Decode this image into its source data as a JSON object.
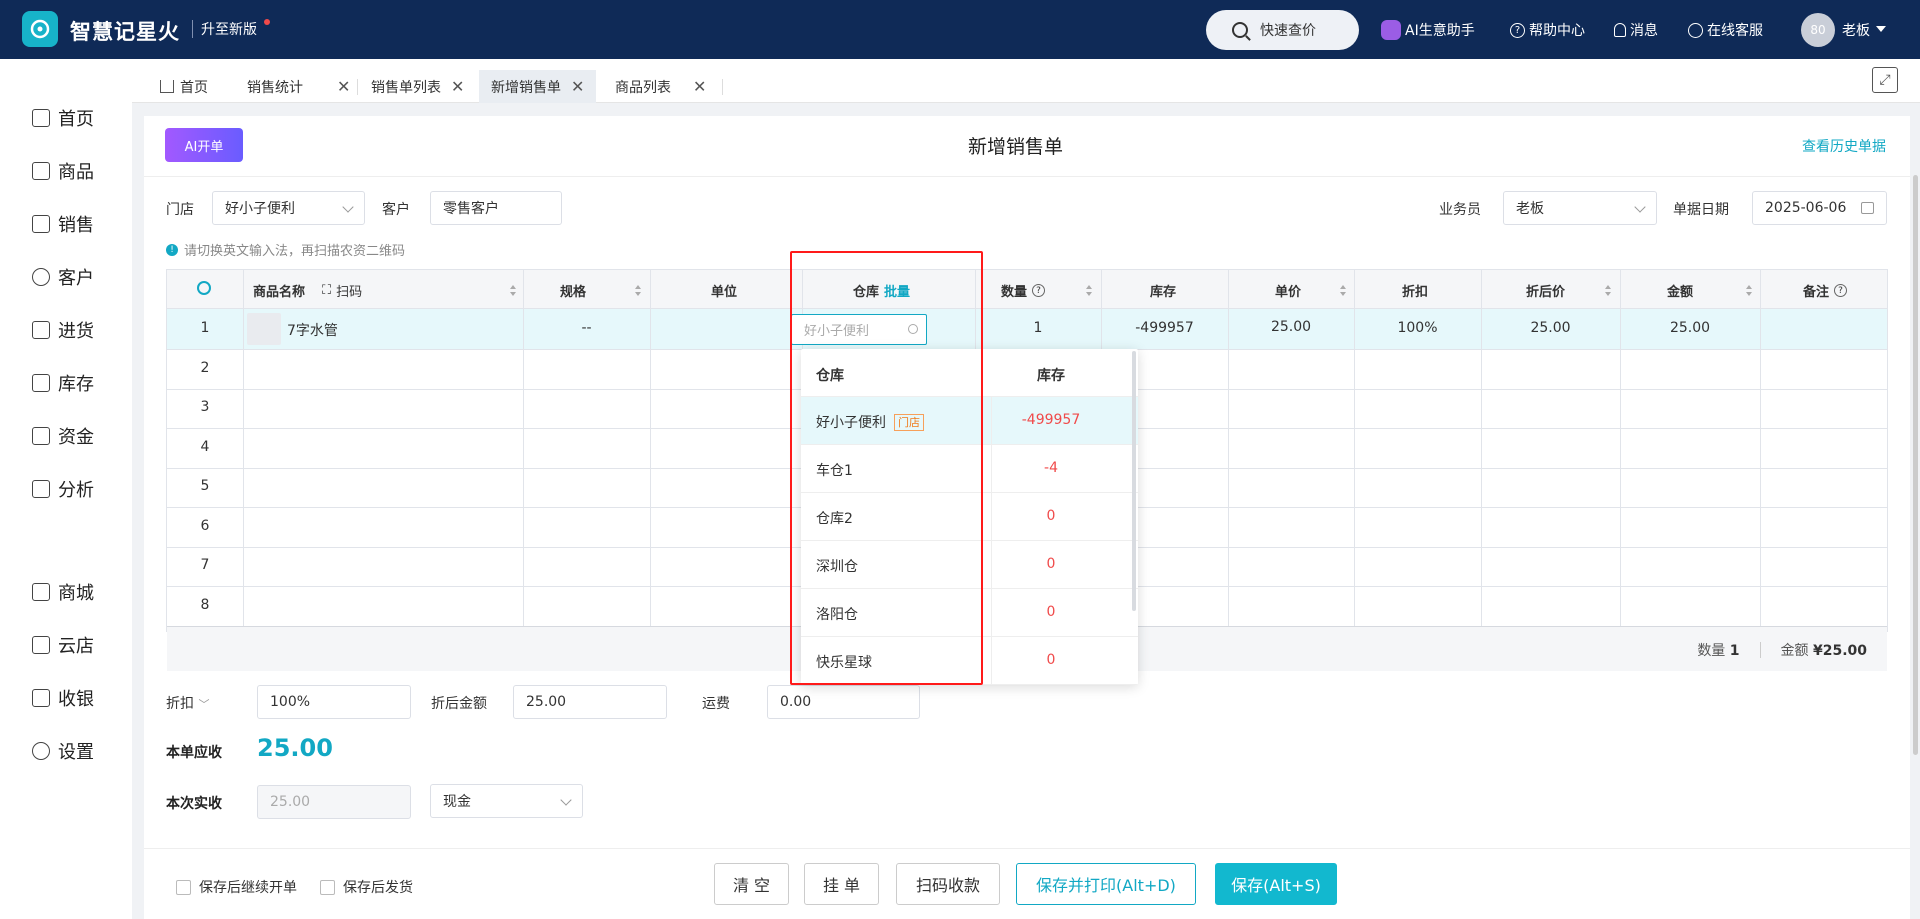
{
  "app": {
    "title": "智慧记星火",
    "upgrade": "升至新版"
  },
  "topbar": {
    "quick_search": "快速查价",
    "ai_assistant": "AI生意助手",
    "help": "帮助中心",
    "messages": "消息",
    "support": "在线客服",
    "avatar_text": "80",
    "user": "老板"
  },
  "sidebar": {
    "items": [
      {
        "label": "首页",
        "icon": "home-icon"
      },
      {
        "label": "商品",
        "icon": "bag-icon"
      },
      {
        "label": "销售",
        "icon": "doc-icon"
      },
      {
        "label": "客户",
        "icon": "user-icon"
      },
      {
        "label": "进货",
        "icon": "import-icon"
      },
      {
        "label": "库存",
        "icon": "warehouse-icon"
      },
      {
        "label": "资金",
        "icon": "money-icon"
      },
      {
        "label": "分析",
        "icon": "chart-icon"
      },
      {
        "label": "商城",
        "icon": "mall-icon"
      },
      {
        "label": "云店",
        "icon": "store-icon"
      },
      {
        "label": "收银",
        "icon": "cashier-icon"
      },
      {
        "label": "设置",
        "icon": "gear-icon"
      }
    ]
  },
  "tabs": [
    {
      "label": "首页"
    },
    {
      "label": "销售统计"
    },
    {
      "label": "销售单列表"
    },
    {
      "label": "新增销售单"
    },
    {
      "label": "商品列表"
    }
  ],
  "page": {
    "ai_button": "AI开单",
    "title": "新增销售单",
    "history_link": "查看历史单据",
    "tip": "请切换英文输入法，再扫描农资二维码"
  },
  "filters": {
    "store_label": "门店",
    "store_value": "好小子便利",
    "customer_label": "客户",
    "customer_value": "零售客户",
    "salesman_label": "业务员",
    "salesman_value": "老板",
    "date_label": "单据日期",
    "date_value": "2025-06-06"
  },
  "table": {
    "headers": {
      "name": "商品名称",
      "scan": "扫码",
      "spec": "规格",
      "unit": "单位",
      "warehouse": "仓库",
      "batch": "批量",
      "qty": "数量",
      "stock": "库存",
      "price": "单价",
      "discount": "折扣",
      "after_price": "折后价",
      "amount": "金额",
      "remark": "备注"
    },
    "row1": {
      "num": "1",
      "name": "7字水管",
      "spec": "--",
      "warehouse_placeholder": "好小子便利",
      "qty": "1",
      "stock": "-499957",
      "price": "25.00",
      "discount": "100%",
      "after_price": "25.00",
      "amount": "25.00"
    },
    "row_numbers": [
      "2",
      "3",
      "4",
      "5",
      "6",
      "7",
      "8"
    ],
    "summary": {
      "qty_label": "数量",
      "qty_value": "1",
      "amount_label": "金额",
      "amount_value": "¥25.00"
    }
  },
  "dropdown": {
    "col_warehouse": "仓库",
    "col_stock": "库存",
    "store_tag": "门店",
    "rows": [
      {
        "name": "好小子便利",
        "stock": "-499957"
      },
      {
        "name": "车仓1",
        "stock": "-4"
      },
      {
        "name": "仓库2",
        "stock": "0"
      },
      {
        "name": "深圳仓",
        "stock": "0"
      },
      {
        "name": "洛阳仓",
        "stock": "0"
      },
      {
        "name": "快乐星球",
        "stock": "0"
      }
    ]
  },
  "bottom": {
    "discount_label": "折扣",
    "discount_value": "100%",
    "after_amount_label": "折后金额",
    "after_amount_value": "25.00",
    "freight_label": "运费",
    "freight_value": "0.00",
    "receivable_label": "本单应收",
    "receivable_value": "25.00",
    "received_label": "本次实收",
    "received_value": "25.00",
    "pay_method": "现金"
  },
  "actions": {
    "continue_label": "保存后继续开单",
    "ship_label": "保存后发货",
    "clear": "清 空",
    "hold": "挂 单",
    "scan_pay": "扫码收款",
    "save_print": "保存并打印(Alt+D)",
    "save": "保存(Alt+S)"
  },
  "colors": {
    "topbar": "#0f2a57",
    "accent": "#12a8c4",
    "danger": "#f04a4a",
    "highlight_frame": "#ff1a1a"
  }
}
